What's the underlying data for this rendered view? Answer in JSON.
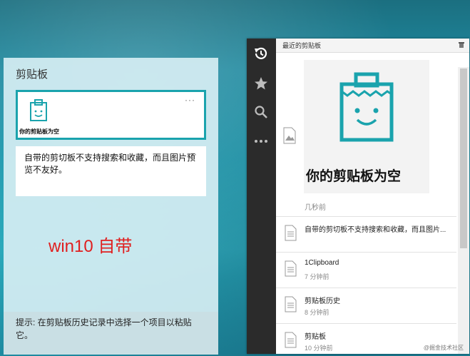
{
  "win10": {
    "title": "剪贴板",
    "card1": {
      "thumb_text": "你的剪贴板为空",
      "more": "···"
    },
    "card2": {
      "text": "自带的剪切板不支持搜索和收藏，而且图片预览不友好。",
      "more": "···"
    },
    "label": "win10 自带",
    "hint": "提示: 在剪贴板历史记录中选择一个项目以粘贴它。"
  },
  "app": {
    "header_title": "最近的剪贴板",
    "empty_text": "你的剪贴板为空",
    "empty_time": "几秒前",
    "items": [
      {
        "title": "自带的剪切板不支持搜索和收藏，而且图片...",
        "time": ""
      },
      {
        "title": "1Clipboard",
        "time": "7 分钟前"
      },
      {
        "title": "剪贴板历史",
        "time": "8 分钟前"
      },
      {
        "title": "剪贴板",
        "time": "10 分钟前"
      }
    ],
    "sidebar": {
      "icons": [
        "history-icon",
        "star-icon",
        "search-icon",
        "more-icon"
      ]
    },
    "watermark": "@掘金技术社区"
  },
  "colors": {
    "accent": "#1aa3ad",
    "label_red": "#e02020",
    "sidebar": "#2b2b2b"
  }
}
